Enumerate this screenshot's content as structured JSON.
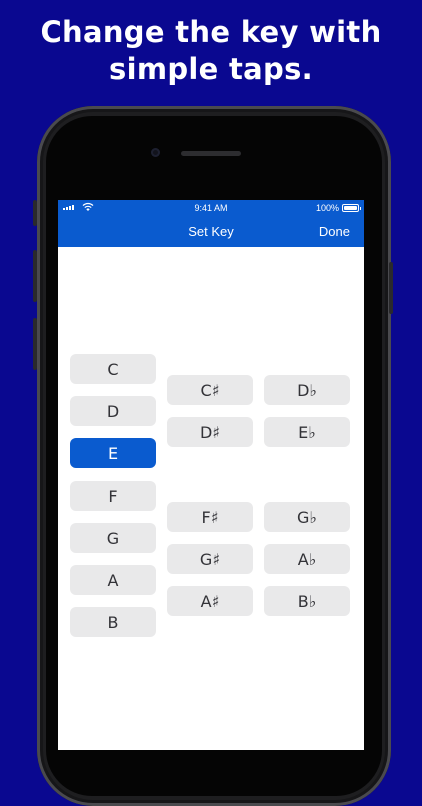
{
  "headline": {
    "line1": "Change the key with",
    "line2": "simple taps."
  },
  "status_bar": {
    "time": "9:41 AM",
    "battery": "100%"
  },
  "nav": {
    "title": "Set Key",
    "done_label": "Done"
  },
  "keys": {
    "naturals": [
      "C",
      "D",
      "E",
      "F",
      "G",
      "A",
      "B"
    ],
    "sharps": [
      "C♯",
      "D♯",
      "F♯",
      "G♯",
      "A♯"
    ],
    "flats": [
      "D♭",
      "E♭",
      "G♭",
      "A♭",
      "B♭"
    ],
    "selected": "E"
  },
  "colors": {
    "background": "#0a0890",
    "accent": "#0a5bcf",
    "key_bg": "#e9e9ea"
  }
}
